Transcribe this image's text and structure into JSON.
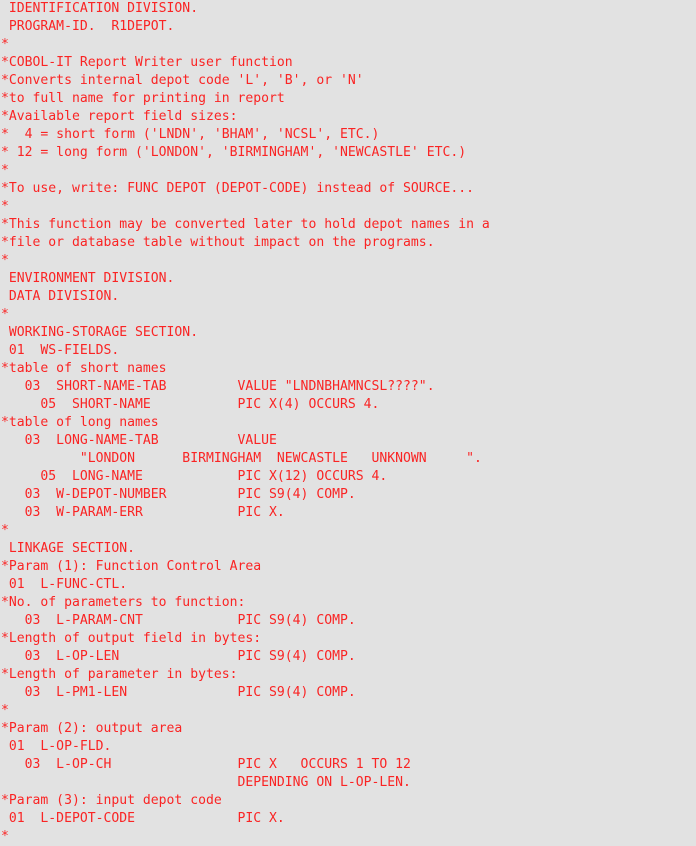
{
  "editor": {
    "background_color": "#e2e2e2",
    "text_color": "#fa2424",
    "program_id": "R1DEPOT",
    "language": "COBOL",
    "line_count": 47
  },
  "source": {
    "lines": [
      " IDENTIFICATION DIVISION.",
      " PROGRAM-ID.  R1DEPOT.",
      "*",
      "*COBOL-IT Report Writer user function",
      "*Converts internal depot code 'L', 'B', or 'N'",
      "*to full name for printing in report",
      "*Available report field sizes:",
      "*  4 = short form ('LNDN', 'BHAM', 'NCSL', ETC.)",
      "* 12 = long form ('LONDON', 'BIRMINGHAM', 'NEWCASTLE' ETC.)",
      "*",
      "*To use, write: FUNC DEPOT (DEPOT-CODE) instead of SOURCE...",
      "*",
      "*This function may be converted later to hold depot names in a",
      "*file or database table without impact on the programs.",
      "*",
      " ENVIRONMENT DIVISION.",
      " DATA DIVISION.",
      "*",
      " WORKING-STORAGE SECTION.",
      " 01  WS-FIELDS.",
      "*table of short names",
      "   03  SHORT-NAME-TAB         VALUE \"LNDNBHAMNCSL????\".",
      "     05  SHORT-NAME           PIC X(4) OCCURS 4.",
      "*table of long names",
      "   03  LONG-NAME-TAB          VALUE",
      "          \"LONDON      BIRMINGHAM  NEWCASTLE   UNKNOWN     \".",
      "     05  LONG-NAME            PIC X(12) OCCURS 4.",
      "   03  W-DEPOT-NUMBER         PIC S9(4) COMP.",
      "   03  W-PARAM-ERR            PIC X.",
      "*",
      " LINKAGE SECTION.",
      "*Param (1): Function Control Area",
      " 01  L-FUNC-CTL.",
      "*No. of parameters to function:",
      "   03  L-PARAM-CNT            PIC S9(4) COMP.",
      "*Length of output field in bytes:",
      "   03  L-OP-LEN               PIC S9(4) COMP.",
      "*Length of parameter in bytes:",
      "   03  L-PM1-LEN              PIC S9(4) COMP.",
      "*",
      "*Param (2): output area",
      " 01  L-OP-FLD.",
      "   03  L-OP-CH                PIC X   OCCURS 1 TO 12",
      "                              DEPENDING ON L-OP-LEN.",
      "*Param (3): input depot code",
      " 01  L-DEPOT-CODE             PIC X.",
      "*"
    ]
  }
}
